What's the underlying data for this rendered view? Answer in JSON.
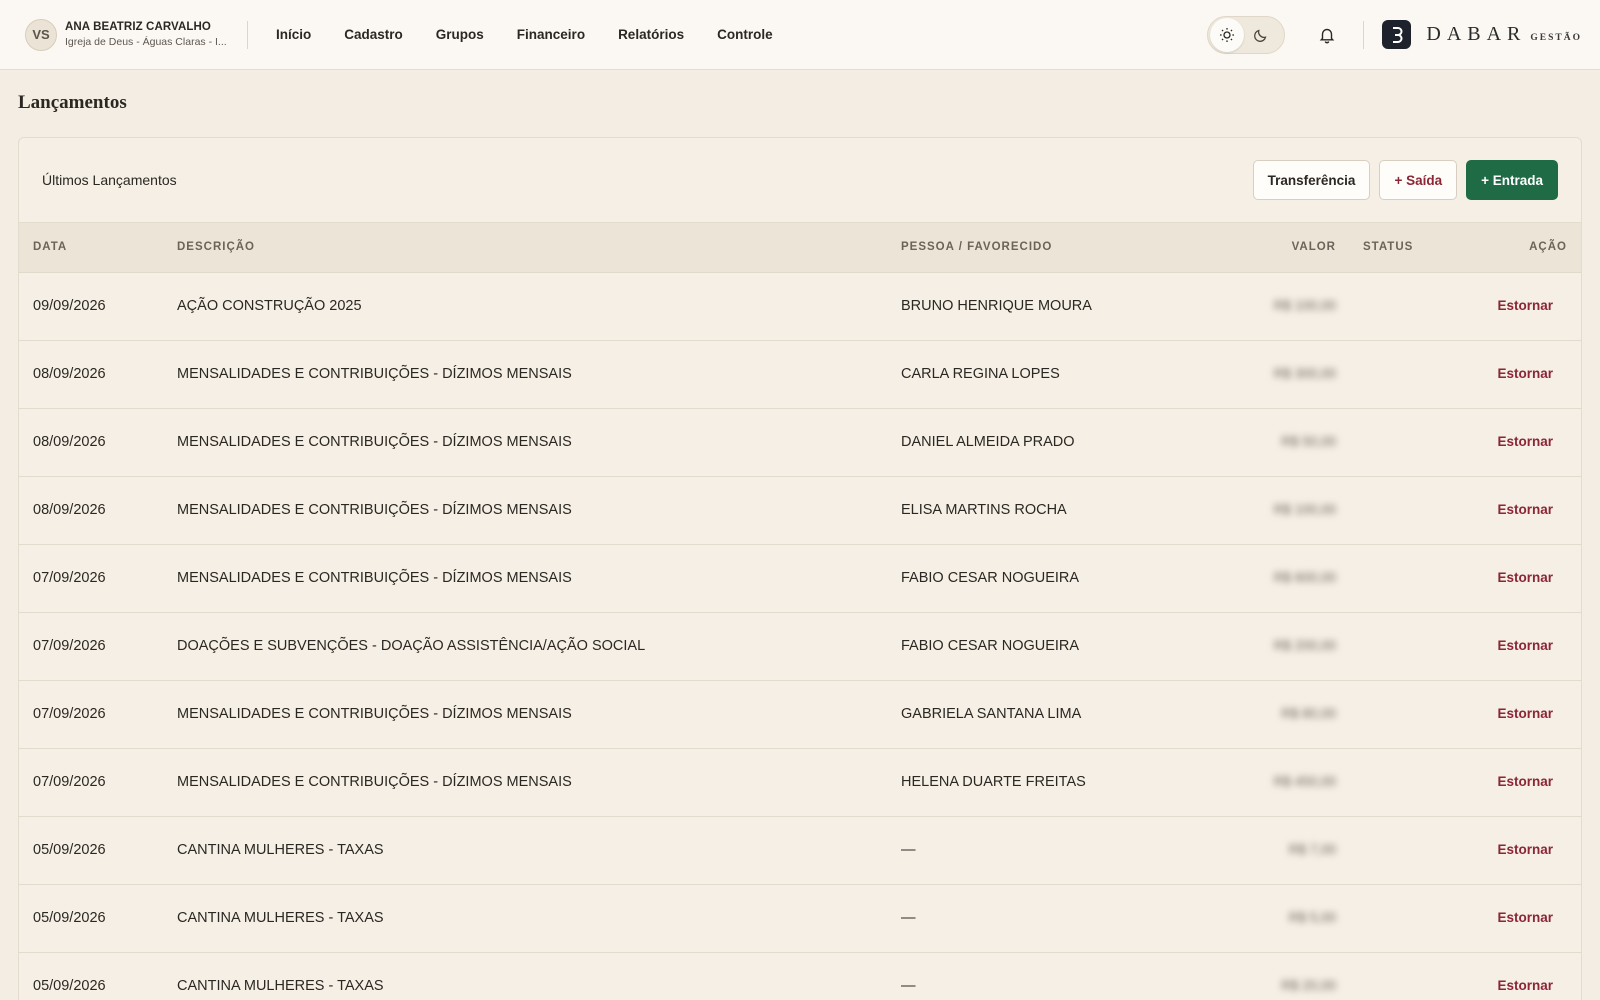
{
  "user": {
    "initials": "VS",
    "name": "ANA BEATRIZ CARVALHO",
    "org": "Igreja de Deus - Águas Claras - I..."
  },
  "nav": [
    "Início",
    "Cadastro",
    "Grupos",
    "Financeiro",
    "Relatórios",
    "Controle"
  ],
  "theme": {
    "active": "light",
    "icons": [
      "sun-icon",
      "moon-icon"
    ]
  },
  "brand": {
    "name": "DABAR",
    "sub": "GESTÃO",
    "logo_color": "#1d222c"
  },
  "page": {
    "title": "Lançamentos"
  },
  "card": {
    "title": "Últimos Lançamentos",
    "buttons": {
      "transfer": "Transferência",
      "saida": "+ Saída",
      "entrada": "+ Entrada"
    }
  },
  "colors": {
    "accent_green": "#1f6b45",
    "accent_red": "#8b2635",
    "background": "#f3ede3"
  },
  "table": {
    "columns": {
      "date": "DATA",
      "desc": "DESCRIÇÃO",
      "person": "PESSOA / FAVORECIDO",
      "value": "VALOR",
      "status": "STATUS",
      "action": "AÇÃO"
    },
    "rows": [
      {
        "date": "09/09/2026",
        "desc": "AÇÃO CONSTRUÇÃO 2025",
        "person": "BRUNO HENRIQUE MOURA",
        "value": "R$ 100,00",
        "status": "",
        "action": "Estornar"
      },
      {
        "date": "08/09/2026",
        "desc": "MENSALIDADES E CONTRIBUIÇÕES - DÍZIMOS MENSAIS",
        "person": "CARLA REGINA LOPES",
        "value": "R$ 300,00",
        "status": "",
        "action": "Estornar"
      },
      {
        "date": "08/09/2026",
        "desc": "MENSALIDADES E CONTRIBUIÇÕES - DÍZIMOS MENSAIS",
        "person": "DANIEL ALMEIDA PRADO",
        "value": "R$ 50,00",
        "status": "",
        "action": "Estornar"
      },
      {
        "date": "08/09/2026",
        "desc": "MENSALIDADES E CONTRIBUIÇÕES - DÍZIMOS MENSAIS",
        "person": "ELISA MARTINS ROCHA",
        "value": "R$ 100,00",
        "status": "",
        "action": "Estornar"
      },
      {
        "date": "07/09/2026",
        "desc": "MENSALIDADES E CONTRIBUIÇÕES - DÍZIMOS MENSAIS",
        "person": "FABIO CESAR NOGUEIRA",
        "value": "R$ 600,00",
        "status": "",
        "action": "Estornar"
      },
      {
        "date": "07/09/2026",
        "desc": "DOAÇÕES E SUBVENÇÕES - DOAÇÃO ASSISTÊNCIA/AÇÃO SOCIAL",
        "person": "FABIO CESAR NOGUEIRA",
        "value": "R$ 200,00",
        "status": "",
        "action": "Estornar"
      },
      {
        "date": "07/09/2026",
        "desc": "MENSALIDADES E CONTRIBUIÇÕES - DÍZIMOS MENSAIS",
        "person": "GABRIELA SANTANA LIMA",
        "value": "R$ 80,00",
        "status": "",
        "action": "Estornar"
      },
      {
        "date": "07/09/2026",
        "desc": "MENSALIDADES E CONTRIBUIÇÕES - DÍZIMOS MENSAIS",
        "person": "HELENA DUARTE FREITAS",
        "value": "R$ 450,00",
        "status": "",
        "action": "Estornar"
      },
      {
        "date": "05/09/2026",
        "desc": "CANTINA MULHERES - TAXAS",
        "person": "—",
        "value": "R$ 7,00",
        "status": "",
        "action": "Estornar"
      },
      {
        "date": "05/09/2026",
        "desc": "CANTINA MULHERES - TAXAS",
        "person": "—",
        "value": "R$ 5,00",
        "status": "",
        "action": "Estornar"
      },
      {
        "date": "05/09/2026",
        "desc": "CANTINA MULHERES - TAXAS",
        "person": "—",
        "value": "R$ 20,00",
        "status": "",
        "action": "Estornar"
      }
    ]
  }
}
